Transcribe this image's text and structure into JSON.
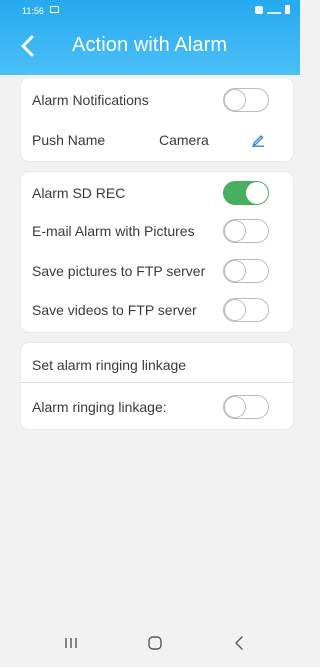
{
  "status_bar": {
    "time": "11:56"
  },
  "header": {
    "title": "Action with Alarm",
    "back_icon": "chevron-left-icon"
  },
  "notifications_card": {
    "alarm_notifications": {
      "label": "Alarm Notifications",
      "enabled": false
    },
    "push_name": {
      "label": "Push Name",
      "value": "Camera",
      "edit_icon": "pencil-icon"
    }
  },
  "recording_card": {
    "alarm_sd_rec": {
      "label": "Alarm SD REC",
      "enabled": true
    },
    "email_alarm": {
      "label": "E-mail Alarm with Pictures",
      "enabled": false
    },
    "ftp_pictures": {
      "label": "Save pictures to FTP server",
      "enabled": false
    },
    "ftp_videos": {
      "label": "Save videos to FTP server",
      "enabled": false
    }
  },
  "ringing_card": {
    "title": "Set alarm ringing linkage",
    "alarm_ringing_linkage": {
      "label": "Alarm ringing linkage:",
      "enabled": false
    }
  },
  "colors": {
    "header": "#2fb0f3",
    "toggle_on": "#46b060",
    "accent_icon": "#2f7fd8"
  },
  "nav_bar": {
    "icons": [
      "recent-apps-icon",
      "home-icon",
      "back-icon"
    ]
  }
}
